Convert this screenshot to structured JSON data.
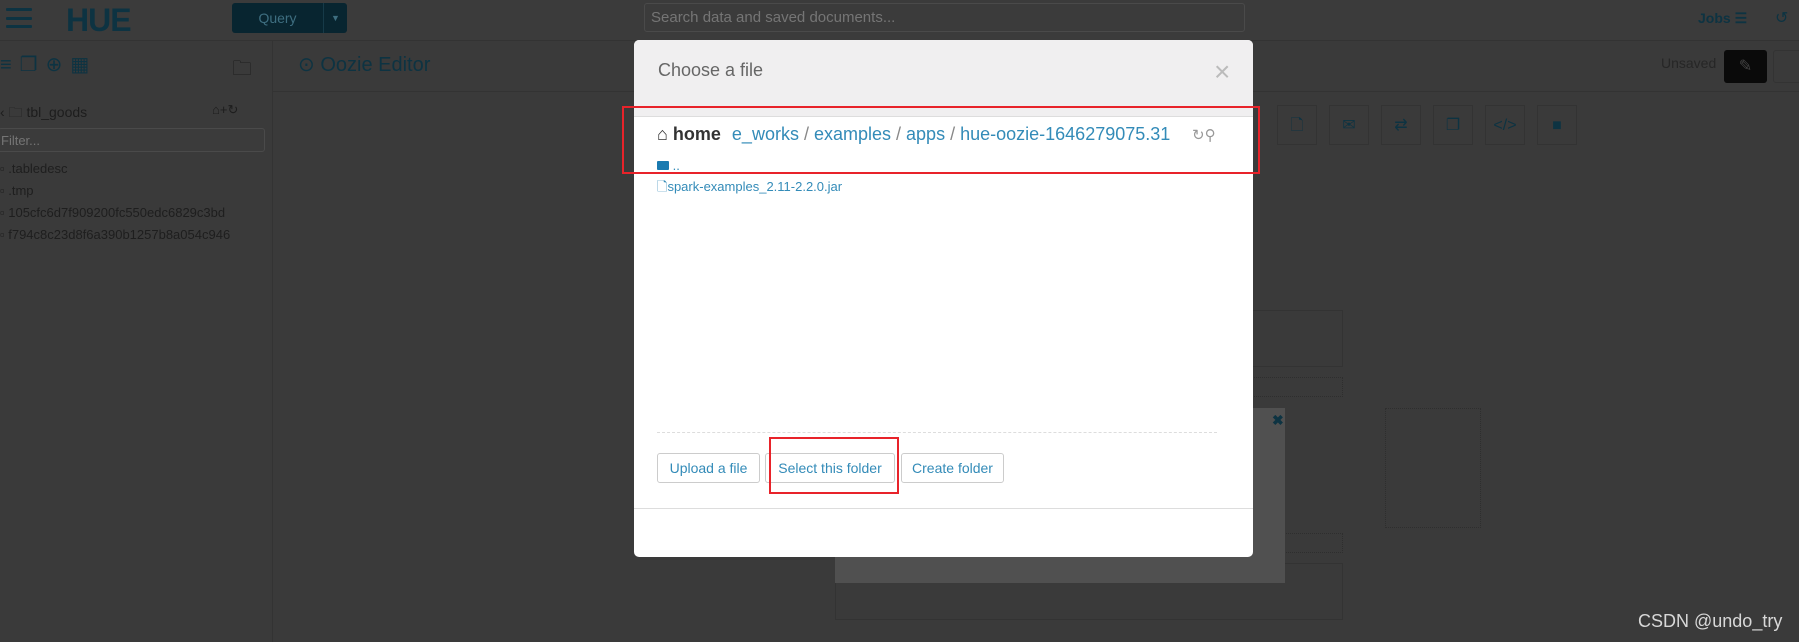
{
  "topbar": {
    "logo": "HUE",
    "query_label": "Query",
    "search_placeholder": "Search data and saved documents...",
    "jobs_label": "Jobs"
  },
  "sidebar": {
    "path": "tbl_goods",
    "filter_placeholder": "Filter...",
    "items": [
      ".tabledesc",
      ".tmp",
      "105cfc6d7f909200fc550edc6829c3bd",
      "f794c8c23d8f6a390b1257b8a054c946"
    ]
  },
  "editor": {
    "title": "Oozie Editor",
    "status": "Unsaved",
    "toolbar_icons": [
      "file-icon",
      "envelope-icon",
      "exchange-icon",
      "copy-icon",
      "code-icon",
      "stop-icon"
    ]
  },
  "modal": {
    "title": "Choose a file",
    "breadcrumb": {
      "home": "home",
      "segments": [
        "e_works",
        "examples",
        "apps",
        "hue-oozie-1646279075.31"
      ],
      "separator": "/"
    },
    "files": [
      {
        "name": "..",
        "type": "folder"
      },
      {
        "name": "spark-examples_2.11-2.2.0.jar",
        "type": "file"
      }
    ],
    "buttons": {
      "upload": "Upload a file",
      "select": "Select this folder",
      "create": "Create folder"
    }
  },
  "annotation_color": "#e8232a",
  "watermark": "CSDN @undo_try"
}
